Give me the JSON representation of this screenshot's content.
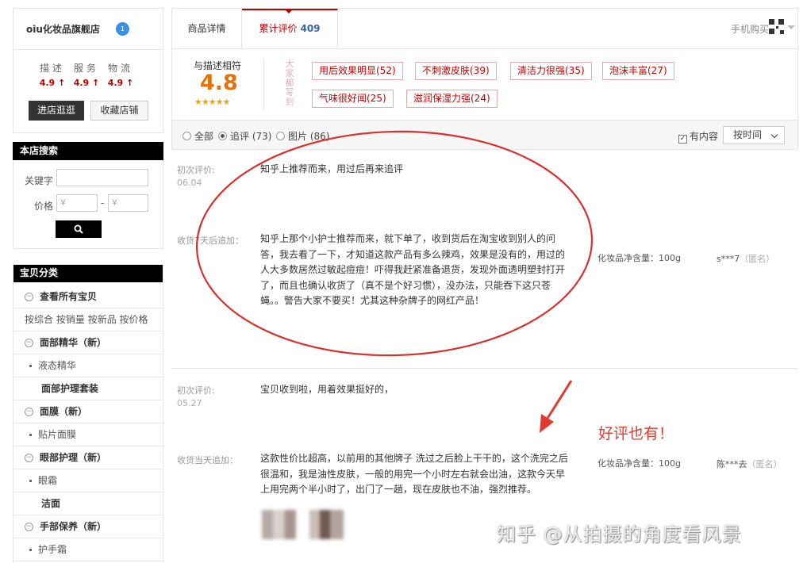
{
  "shop": {
    "name": "oiu化妆品旗舰店",
    "badge": "1",
    "ratings": [
      {
        "label": "描述",
        "value": "4.9 ↑"
      },
      {
        "label": "服务",
        "value": "4.9 ↑"
      },
      {
        "label": "物流",
        "value": "4.9 ↑"
      }
    ],
    "enter_label": "进店逛逛",
    "fav_label": "收藏店铺"
  },
  "search": {
    "title": "本店搜索",
    "keyword_label": "关键字",
    "price_label": "价格",
    "currency": "¥",
    "dash": "-"
  },
  "categories": {
    "title": "宝贝分类",
    "view_all": "查看所有宝贝",
    "sort_links": [
      "按综合",
      "按销量",
      "按新品",
      "按价格"
    ],
    "items": [
      {
        "type": "main",
        "label": "面部精华（新）"
      },
      {
        "type": "sub",
        "label": "液态精华"
      },
      {
        "type": "sub2",
        "label": "面部护理套装"
      },
      {
        "type": "main",
        "label": "面膜（新）"
      },
      {
        "type": "sub",
        "label": "贴片面膜"
      },
      {
        "type": "main",
        "label": "眼部护理（新）"
      },
      {
        "type": "sub",
        "label": "眼霜"
      },
      {
        "type": "sub2",
        "label": "洁面"
      },
      {
        "type": "main",
        "label": "手部保养（新）"
      },
      {
        "type": "sub",
        "label": "护手霜"
      }
    ]
  },
  "tabs": {
    "detail": "商品详情",
    "reviews": "累计评价",
    "reviews_count": "409",
    "mobile_buy": "手机购买"
  },
  "summary": {
    "label": "与描述相符",
    "score": "4.8",
    "stars": "★★★★★",
    "side_text": "大家都写到",
    "tags": [
      "用后效果明显(52)",
      "不刺激皮肤(39)",
      "清洁力很强(35)",
      "泡沫丰富(27)",
      "气味很好闻(25)",
      "滋润保湿力强(24)"
    ]
  },
  "filters": {
    "all": "全部",
    "followup": "追评 (73)",
    "photos": "图片 (86)",
    "has_content": "有内容",
    "sort": "按时间"
  },
  "reviews": [
    {
      "first_label": "初次评价:",
      "first_date": "06.04",
      "first_text": "知乎上推荐而来，用过后再来追评",
      "followup_label": "收货7天后追加：",
      "followup_text": "知乎上那个小护士推荐而来，就下单了，收到货后在淘宝收到别人的问答，我去看了一下，才知道这款产品有多么辣鸡，效果是没有的，用过的人大多数居然过敏起痘痘！吓得我赶紧准备退货，发现外面透明塑封打开了，而且也确认收货了（真不是个好习惯），没办法，只能吞下这只苍蝇。。警告大家不要买！尤其这种杂牌子的网红产品！",
      "spec": "化妆品净含量：100g",
      "user": "s***7",
      "anon": "（匿名）"
    },
    {
      "first_label": "初次评价:",
      "first_date": "05.27",
      "first_text": "宝贝收到啦，用着效果挺好的，",
      "followup_label": "收货当天追加：",
      "followup_text": "这款性价比超高，以前用的其他牌子 洗过之后脸上干干的，这个洗完之后很温和，我是油性皮肤，一般的用完一个小时左右就会出油，这款今天早上用完两个半小时了，出门了一趟，现在皮肤也不油，强烈推荐。",
      "spec": "化妆品净含量：100g",
      "user": "陈***去",
      "anon": "（匿名）"
    }
  ],
  "annotation": "好评也有！",
  "watermark": "知乎 @从拍摄的角度看风景",
  "colors": {
    "accent": "#c40000",
    "score": "#e4720a",
    "annotation": "#e23b2e",
    "link_count": "#3366aa"
  }
}
